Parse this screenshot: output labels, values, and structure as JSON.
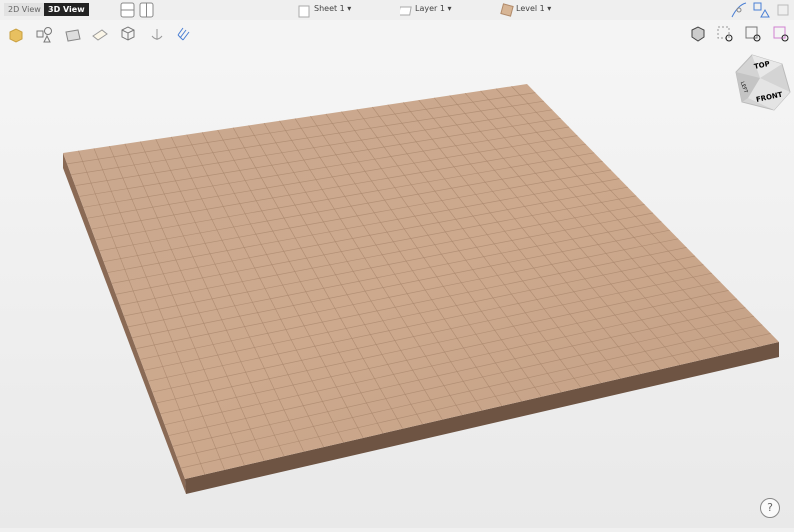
{
  "tabs": {
    "view_2d": "2D View",
    "view_3d": "3D View"
  },
  "dropdowns": {
    "sheet": "Sheet 1 ▾",
    "layer": "Layer 1 ▾",
    "level": "Level 1 ▾"
  },
  "view_cube": {
    "top": "TOP",
    "front": "FRONT",
    "left": "LEFT"
  },
  "help": "?",
  "colors": {
    "board_top": "#c9a68b",
    "board_line": "#a8856b",
    "board_side": "#6e5443"
  }
}
